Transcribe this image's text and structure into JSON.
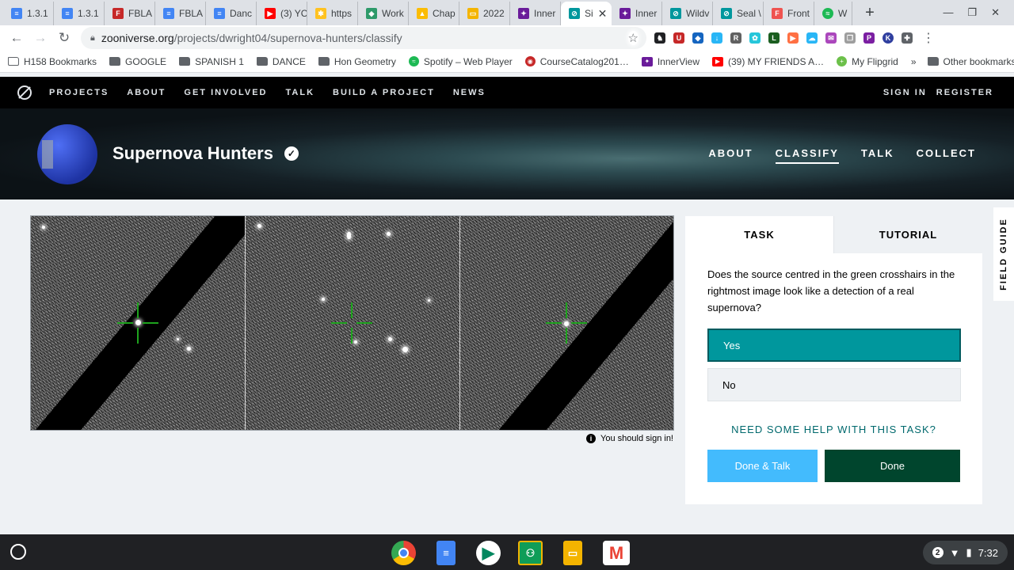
{
  "browser": {
    "tabs": [
      {
        "title": "1.3.1",
        "icon": "google-docs-icon",
        "color": "#4285f4"
      },
      {
        "title": "1.3.1",
        "icon": "google-docs-icon",
        "color": "#4285f4"
      },
      {
        "title": "FBLA",
        "icon": "fbla-icon",
        "color": "#c62828"
      },
      {
        "title": "FBLA",
        "icon": "google-docs-icon",
        "color": "#4285f4"
      },
      {
        "title": "Danc",
        "icon": "google-docs-icon",
        "color": "#4285f4"
      },
      {
        "title": "(3) YC",
        "icon": "youtube-icon",
        "color": "#ff0000"
      },
      {
        "title": "https",
        "icon": "walmart-icon",
        "color": "#ffc220"
      },
      {
        "title": "Work",
        "icon": "work-icon",
        "color": "#2e9a6a"
      },
      {
        "title": "Chap",
        "icon": "google-drive-icon",
        "color": "#fbbc04"
      },
      {
        "title": "2022",
        "icon": "google-slides-icon",
        "color": "#f4b400"
      },
      {
        "title": "Inner",
        "icon": "innerview-icon",
        "color": "#6a1b9a"
      },
      {
        "title": "Si",
        "icon": "zooniverse-icon",
        "color": "#00979d",
        "active": true
      },
      {
        "title": "Inner",
        "icon": "innerview-icon",
        "color": "#6a1b9a"
      },
      {
        "title": "Wildv",
        "icon": "zooniverse-icon",
        "color": "#00979d"
      },
      {
        "title": "Seal \\",
        "icon": "zooniverse-icon",
        "color": "#00979d"
      },
      {
        "title": "Front",
        "icon": "fs-icon",
        "color": "#ef5350"
      },
      {
        "title": "W",
        "icon": "spotify-icon",
        "color": "#1db954"
      }
    ],
    "new_tab": "+",
    "window_controls": [
      "—",
      "❐",
      "✕"
    ],
    "url_domain": "zooniverse.org",
    "url_path": "/projects/dwright04/supernova-hunters/classify",
    "bookmarks": [
      {
        "label": "H158 Bookmarks",
        "icon": "folder-icon"
      },
      {
        "label": "GOOGLE",
        "icon": "folder-icon"
      },
      {
        "label": "SPANISH 1",
        "icon": "folder-icon"
      },
      {
        "label": "DANCE",
        "icon": "folder-icon"
      },
      {
        "label": "Hon Geometry",
        "icon": "folder-icon"
      },
      {
        "label": "Spotify – Web Player",
        "icon": "spotify-icon",
        "color": "#1db954"
      },
      {
        "label": "CourseCatalog201…",
        "icon": "course-icon",
        "color": "#c62828"
      },
      {
        "label": "InnerView",
        "icon": "innerview-icon",
        "color": "#6a1b9a"
      },
      {
        "label": "(39) MY FRIENDS A…",
        "icon": "youtube-icon",
        "color": "#ff0000"
      },
      {
        "label": "My Flipgrid",
        "icon": "flipgrid-icon",
        "color": "#6cc04a"
      }
    ],
    "bookmarks_more": "»",
    "other_bookmarks": "Other bookmarks"
  },
  "zooniverse_nav": {
    "items": [
      "PROJECTS",
      "ABOUT",
      "GET INVOLVED",
      "TALK",
      "BUILD A PROJECT",
      "NEWS"
    ],
    "sign_in": "SIGN IN",
    "register": "REGISTER"
  },
  "project": {
    "title": "Supernova Hunters",
    "nav": [
      "ABOUT",
      "CLASSIFY",
      "TALK",
      "COLLECT"
    ],
    "active_nav": "CLASSIFY"
  },
  "viewer": {
    "notice": "You should sign in!"
  },
  "task": {
    "tab_task": "TASK",
    "tab_tutorial": "TUTORIAL",
    "question": "Does the source centred in the green crosshairs in the rightmost image look like a detection of a real supernova?",
    "answers": [
      "Yes",
      "No"
    ],
    "selected": "Yes",
    "help": "NEED SOME HELP WITH THIS TASK?",
    "done_talk": "Done & Talk",
    "done": "Done"
  },
  "field_guide": "FIELD GUIDE",
  "shelf": {
    "apps": [
      "chrome-icon",
      "google-docs-icon",
      "play-store-icon",
      "google-classroom-icon",
      "google-slides-icon",
      "gmail-icon"
    ],
    "notification_count": "2",
    "time": "7:32"
  },
  "colors": {
    "accent": "#00979d",
    "done_button": "#00452d",
    "done_talk_button": "#43bbfd",
    "crosshair": "#1ea31e"
  }
}
